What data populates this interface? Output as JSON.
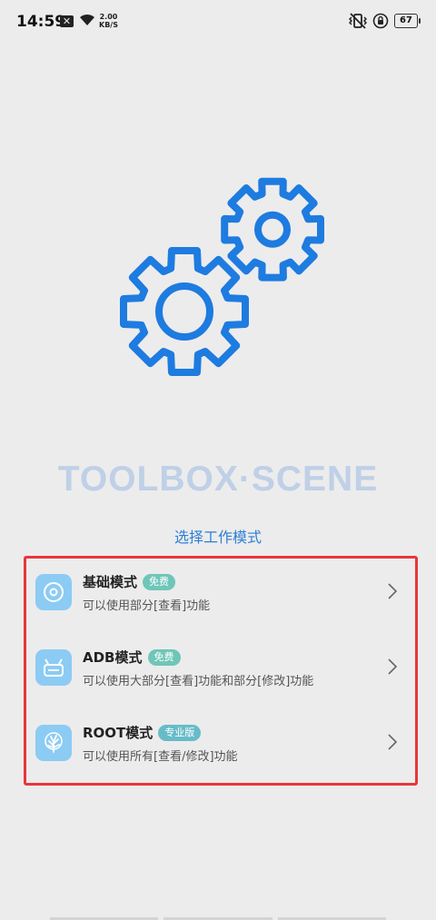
{
  "status_bar": {
    "time": "14:59",
    "notif_glyph": "✕",
    "net_speed_value": "2.00",
    "net_speed_unit": "KB/S",
    "battery": "67",
    "icons": [
      "wifi-icon",
      "vibrate-icon",
      "lock-rotation-icon",
      "battery-icon"
    ]
  },
  "app": {
    "brand": "TOOLBOX·SCENE",
    "section_title": "选择工作模式"
  },
  "modes": [
    {
      "name": "基础模式",
      "badge": "免费",
      "desc": "可以使用部分[查看]功能",
      "icon": "disc-icon"
    },
    {
      "name": "ADB模式",
      "badge": "免费",
      "desc": "可以使用大部分[查看]功能和部分[修改]功能",
      "icon": "android-icon"
    },
    {
      "name": "ROOT模式",
      "badge": "专业版",
      "desc": "可以使用所有[查看/修改]功能",
      "icon": "tree-icon"
    }
  ],
  "colors": {
    "accent": "#1e7be0",
    "highlight_border": "#e8363a",
    "badge_green": "#6fc6b8",
    "icon_bg": "#8ccbf4",
    "brand_text": "#bfd0e7"
  }
}
